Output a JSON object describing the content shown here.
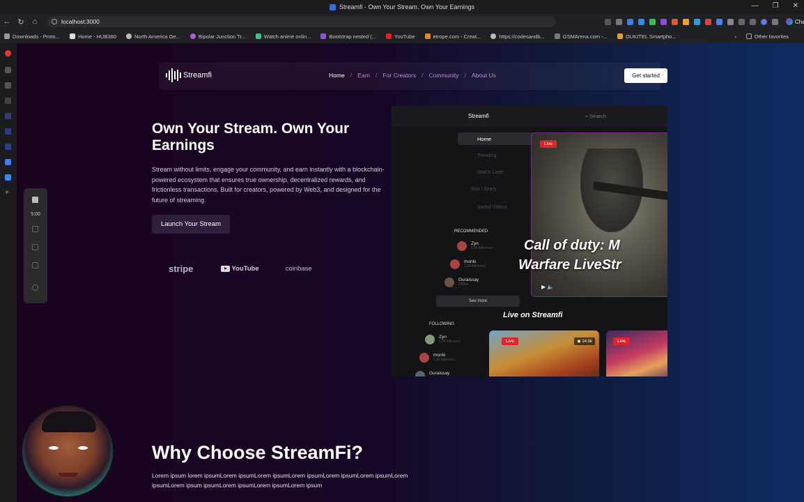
{
  "browser": {
    "tab_title": "Streamfi - Own Your Stream. Own Your Earnings",
    "url": "localhost:3000",
    "chat_label": "Chat",
    "bookmarks": [
      "Downloads - Proto...",
      "Home - HUB360",
      "North America Ge...",
      "Bipolar Junction Tr...",
      "Watch anime onlin...",
      "Bootstrap nested (...",
      "YouTube",
      "etrope.com - Creat...",
      "https://codesandb...",
      "GSMArena.com -...",
      "OUKITEL Smartpho..."
    ],
    "other_favorites": "Other favorites"
  },
  "nav": {
    "logo": "Streamfi",
    "links": [
      "Home",
      "Earn",
      "For Creators",
      "Community",
      "About Us"
    ],
    "cta": "Get started"
  },
  "hero": {
    "title": "Own Your Stream. Own Your Earnings",
    "description": "Stream without limits, engage your community, and earn instantly with a blockchain-powered ecosystem that ensures true ownership, decentralized rewards, and frictionless transactions. Built for creators, powered by Web3, and designed for the future of streaming.",
    "cta": "Launch Your Stream",
    "brands": [
      "stripe",
      "YouTube",
      "coinbase"
    ]
  },
  "mockup": {
    "logo": "Streamfi",
    "search_placeholder": "Search",
    "menu": [
      "Home",
      "Trending",
      "Watch Later",
      "Your Library",
      "Saved Videos"
    ],
    "recommended_heading": "RECOMMENDED",
    "recommended": [
      {
        "name": "Zyn",
        "sub": "1.5k followers"
      },
      {
        "name": "monki",
        "sub": "1.2k followers"
      },
      {
        "name": "Guraissay",
        "sub": "Offline"
      }
    ],
    "see_more": "See more",
    "following_heading": "FOLLOWING",
    "following": [
      {
        "name": "Zyn",
        "sub": "1.5k followers"
      },
      {
        "name": "monki",
        "sub": "1.2k followers"
      },
      {
        "name": "Guraissay",
        "sub": ""
      }
    ],
    "live_badge": "Live",
    "stream_title": "Call of duty: Modern Warfare LiveStream",
    "stream_title_line1": "Call of duty: M",
    "stream_title_line2": "Warfare LiveStr",
    "live_section": "Live on Streamfi",
    "viewers": "14.5k"
  },
  "recorder": {
    "time": "5:00"
  },
  "why": {
    "title": "Why Choose StreamFi?",
    "description": "Lorem ipsum lorem ipsumLorem ipsumLorem ipsumLorem ipsumLorem ipsumLorem ipsumLorem ipsumLorem ipsum ipsumLorem ipsumLorem ipsumLorem ipsum"
  }
}
